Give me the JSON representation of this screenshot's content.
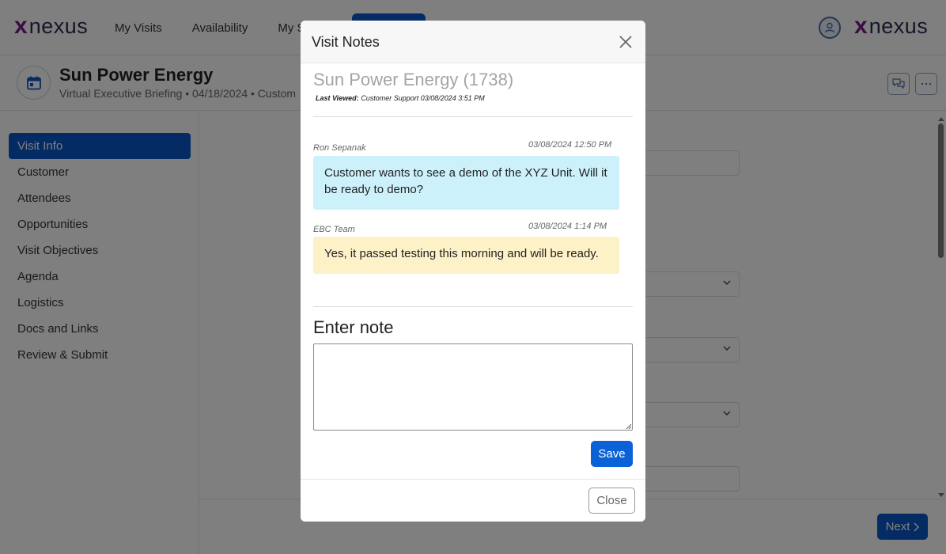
{
  "topbar": {
    "logo_mark": "x",
    "logo_word": "nexus",
    "nav": [
      "My Visits",
      "Availability",
      "My St"
    ]
  },
  "visit": {
    "title": "Sun Power Energy",
    "subtitle": "Virtual Executive Briefing • 04/18/2024 • Custom"
  },
  "sidebar": {
    "items": [
      {
        "label": "Visit Info",
        "active": true
      },
      {
        "label": "Customer"
      },
      {
        "label": "Attendees"
      },
      {
        "label": "Opportunities"
      },
      {
        "label": "Visit Objectives"
      },
      {
        "label": "Agenda"
      },
      {
        "label": "Logistics"
      },
      {
        "label": "Docs and Links"
      },
      {
        "label": "Review & Submit"
      }
    ]
  },
  "footer": {
    "next_label": "Next"
  },
  "modal": {
    "title": "Visit Notes",
    "company": "Sun Power Energy (1738)",
    "last_viewed_label": "Last Viewed:",
    "last_viewed_value": "Customer Support 03/08/2024 3:51 PM",
    "notes": [
      {
        "author": "Ron Sepanak",
        "time": "03/08/2024 12:50 PM",
        "text": "Customer wants to see a demo of the XYZ Unit. Will it be ready to demo?",
        "color": "#cdf1fb"
      },
      {
        "author": "EBC Team",
        "time": "03/08/2024 1:14 PM",
        "text": "Yes, it passed testing this morning and will be ready.",
        "color": "#fdf1c8"
      }
    ],
    "enter_label": "Enter note",
    "input_value": "",
    "save_label": "Save",
    "close_label": "Close"
  },
  "colors": {
    "primary": "#0a57c9",
    "logo_x": "#7a1b8c",
    "logo_word": "#2b2f52"
  }
}
